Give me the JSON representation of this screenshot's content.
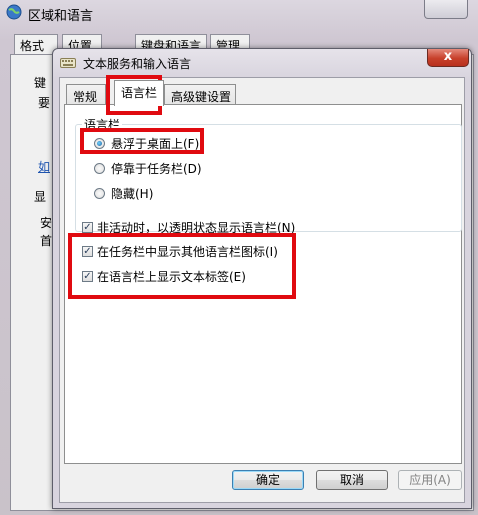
{
  "background_window": {
    "title": "区域和语言",
    "tabs": [
      "格式",
      "位置",
      "键盘和语言",
      "管理"
    ],
    "fragments": [
      "键",
      "要",
      "如",
      "显",
      "安",
      "首"
    ]
  },
  "dialog": {
    "title": "文本服务和输入语言",
    "close_glyph": "x",
    "tabs": [
      {
        "label": "常规",
        "active": false
      },
      {
        "label": "语言栏",
        "active": true
      },
      {
        "label": "高级键设置",
        "active": false
      }
    ],
    "language_bar": {
      "group_label": "语言栏",
      "options": [
        {
          "label": "悬浮于桌面上(F)",
          "selected": true
        },
        {
          "label": "停靠于任务栏(D)",
          "selected": false
        },
        {
          "label": "隐藏(H)",
          "selected": false
        }
      ]
    },
    "checkboxes": [
      {
        "label": "非活动时，以透明状态显示语言栏(N)",
        "checked": true
      },
      {
        "label": "在任务栏中显示其他语言栏图标(I)",
        "checked": true
      },
      {
        "label": "在语言栏上显示文本标签(E)",
        "checked": true
      }
    ],
    "buttons": {
      "ok": "确定",
      "cancel": "取消",
      "apply": "应用(A)"
    }
  },
  "colors": {
    "highlight_red": "#e00a10",
    "close_red": "#c7402b",
    "link_blue": "#1f55b0"
  }
}
